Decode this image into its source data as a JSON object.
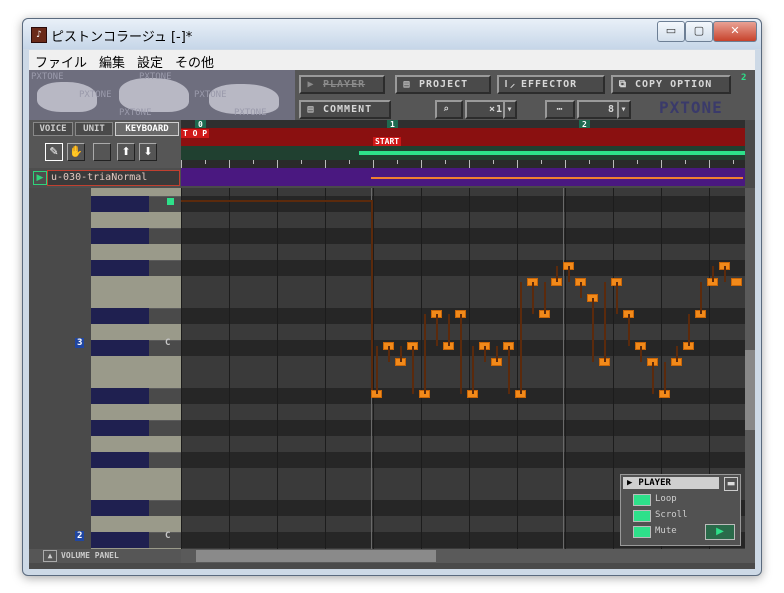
{
  "window": {
    "title": "ピストンコラージュ [-]*",
    "minimize": "▭",
    "maximize": "▢",
    "close": "✕"
  },
  "menu": [
    "ファイル",
    "編集",
    "設定",
    "その他"
  ],
  "banner": {
    "ghost_text": "PXTONE"
  },
  "toolbar": {
    "player": "PLAYER",
    "project": "PROJECT",
    "effector": "EFFECTOR",
    "copy": "COPY",
    "option": "OPTION",
    "comment": "COMMENT",
    "zoom": "×1",
    "division": "8",
    "logo": "PXTONE",
    "corner_number": "2"
  },
  "tabs": {
    "voice": "VOICE",
    "unit": "UNIT",
    "keyboard": "KEYBOARD"
  },
  "unit": {
    "name": "u-030-triaNormal"
  },
  "ruler": {
    "measures": [
      "0",
      "1",
      "2"
    ],
    "top_marker": "T O P",
    "start_marker": "START"
  },
  "keyboard": {
    "octave_upper": "3",
    "octave_lower": "2",
    "c_label": "C"
  },
  "volume_panel": "VOLUME PANEL",
  "player_panel": {
    "title": "PLAYER",
    "loop": "Loop",
    "scroll": "Scroll",
    "mute": "Mute",
    "play": "▶"
  },
  "colors": {
    "note": "#f28a1a",
    "ruler_red": "#8a1010",
    "ruler_green": "#2ee08a",
    "unit_lane": "#4a1880"
  }
}
